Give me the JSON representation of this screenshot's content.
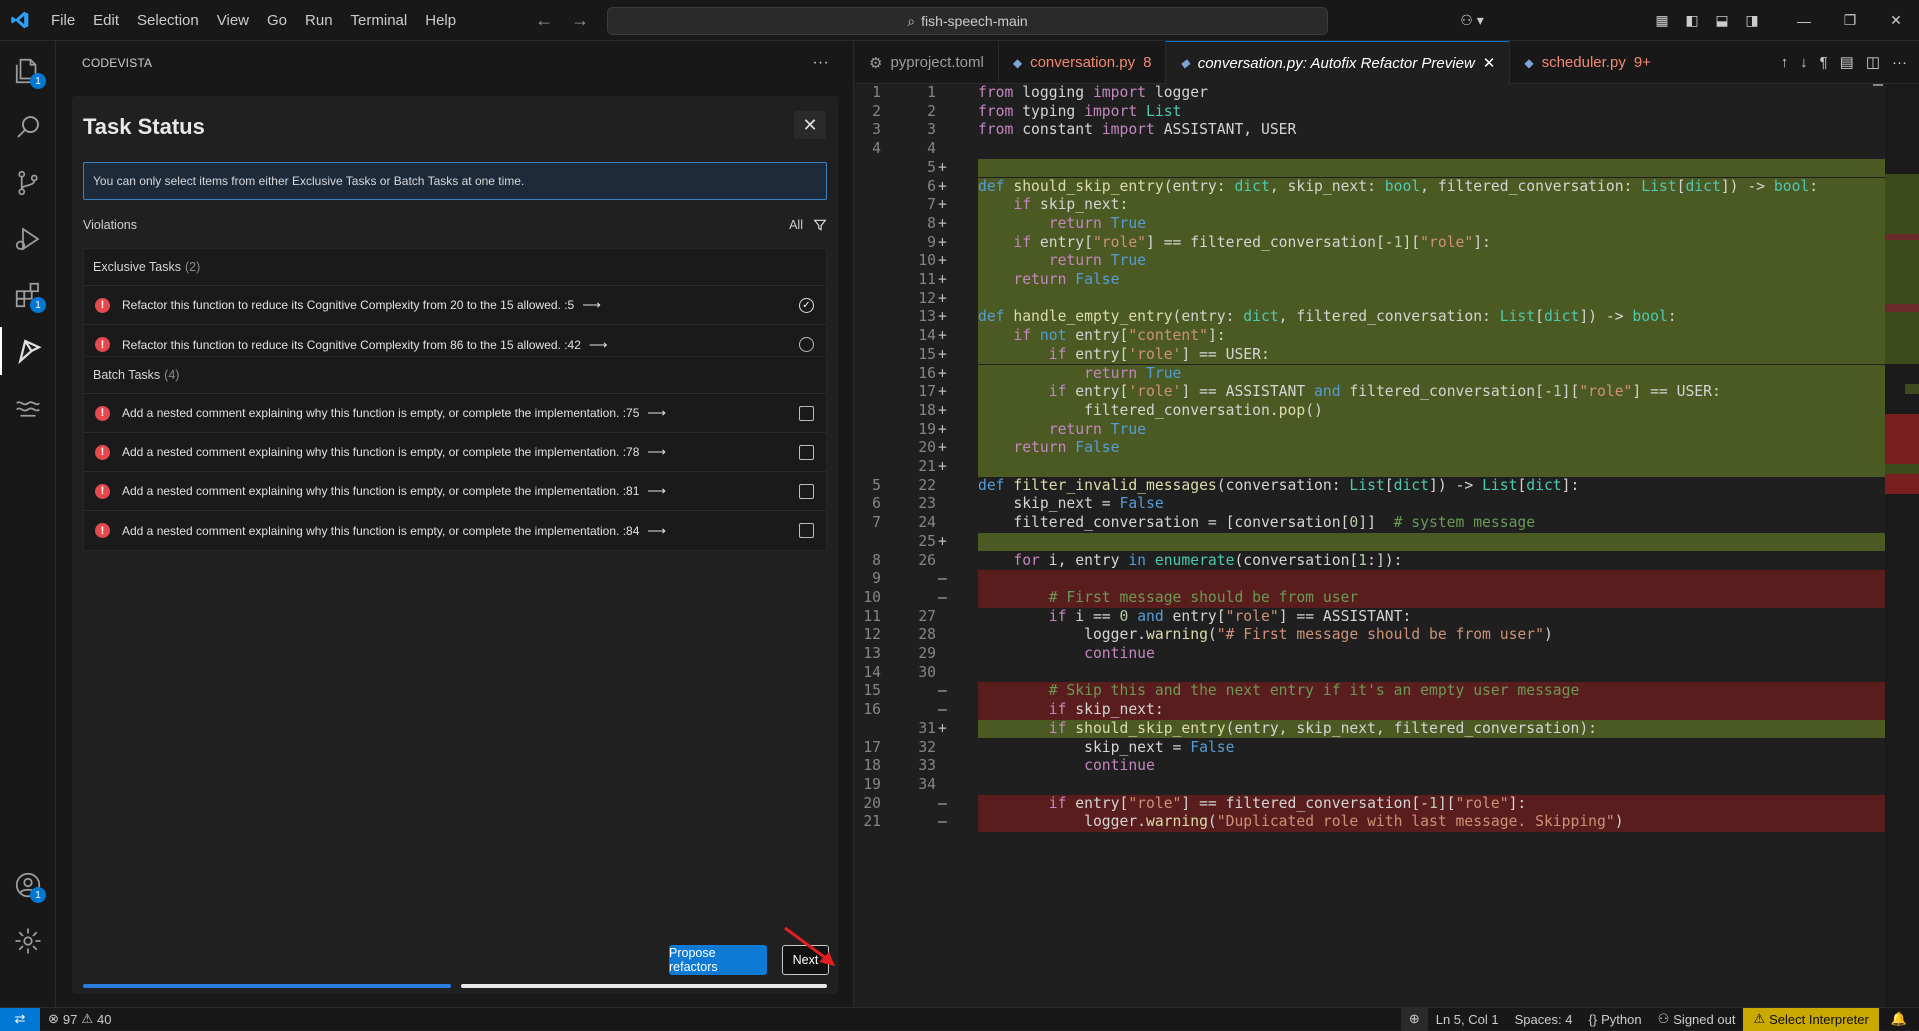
{
  "menu": [
    "File",
    "Edit",
    "Selection",
    "View",
    "Go",
    "Run",
    "Terminal",
    "Help"
  ],
  "search": {
    "text": "fish-speech-main"
  },
  "activity_badges": {
    "explorer": "1",
    "extensions": "1",
    "accounts": "1"
  },
  "sidebar": {
    "title": "CODEVISTA",
    "more": "···"
  },
  "panel": {
    "title": "Task Status",
    "close": "✕",
    "info": "You can only select items from either Exclusive Tasks or Batch Tasks at one time.",
    "violations_label": "Violations",
    "filter_label": "All",
    "exclusive": {
      "title": "Exclusive Tasks",
      "count": "(2)",
      "items": [
        {
          "text": "Refactor this function to reduce its Cognitive Complexity from 20 to the 15 allowed. :5",
          "state": "checked"
        },
        {
          "text": "Refactor this function to reduce its Cognitive Complexity from 86 to the 15 allowed. :42",
          "state": "unchecked"
        }
      ]
    },
    "batch": {
      "title": "Batch Tasks",
      "count": "(4)",
      "items": [
        {
          "text": "Add a nested comment explaining why this function is empty, or complete the implementation. :75"
        },
        {
          "text": "Add a nested comment explaining why this function is empty, or complete the implementation. :78"
        },
        {
          "text": "Add a nested comment explaining why this function is empty, or complete the implementation. :81"
        },
        {
          "text": "Add a nested comment explaining why this function is empty, or complete the implementation. :84"
        }
      ]
    },
    "propose_label": "Propose refactors",
    "next_label": "Next"
  },
  "tabs": [
    {
      "label": "pyproject.toml",
      "badge": ""
    },
    {
      "label": "conversation.py",
      "badge": "8"
    },
    {
      "label": "conversation.py: Autofix Refactor Preview",
      "badge": ""
    },
    {
      "label": "scheduler.py",
      "badge": "9+"
    }
  ],
  "editor": {
    "lines": [
      {
        "l": "1",
        "r": "1",
        "m": "",
        "t": "plain",
        "c": "from logging import logger"
      },
      {
        "l": "2",
        "r": "2",
        "m": "",
        "t": "plain",
        "c": "from typing import List"
      },
      {
        "l": "3",
        "r": "3",
        "m": "",
        "t": "plain",
        "c": "from constant import ASSISTANT, USER"
      },
      {
        "l": "4",
        "r": "4",
        "m": "",
        "t": "plain",
        "c": ""
      },
      {
        "l": "",
        "r": "5",
        "m": "+",
        "t": "add",
        "c": ""
      },
      {
        "l": "",
        "r": "6",
        "m": "+",
        "t": "add",
        "c": "def should_skip_entry(entry: dict, skip_next: bool, filtered_conversation: List[dict]) -> bool:"
      },
      {
        "l": "",
        "r": "7",
        "m": "+",
        "t": "add",
        "c": "    if skip_next:"
      },
      {
        "l": "",
        "r": "8",
        "m": "+",
        "t": "add",
        "c": "        return True"
      },
      {
        "l": "",
        "r": "9",
        "m": "+",
        "t": "add",
        "c": "    if entry[\"role\"] == filtered_conversation[-1][\"role\"]:"
      },
      {
        "l": "",
        "r": "10",
        "m": "+",
        "t": "add",
        "c": "        return True"
      },
      {
        "l": "",
        "r": "11",
        "m": "+",
        "t": "add",
        "c": "    return False"
      },
      {
        "l": "",
        "r": "12",
        "m": "+",
        "t": "add",
        "c": ""
      },
      {
        "l": "",
        "r": "13",
        "m": "+",
        "t": "add",
        "c": "def handle_empty_entry(entry: dict, filtered_conversation: List[dict]) -> bool:"
      },
      {
        "l": "",
        "r": "14",
        "m": "+",
        "t": "add",
        "c": "    if not entry[\"content\"]:"
      },
      {
        "l": "",
        "r": "15",
        "m": "+",
        "t": "add",
        "c": "        if entry['role'] == USER:"
      },
      {
        "l": "",
        "r": "16",
        "m": "+",
        "t": "add",
        "c": "            return True"
      },
      {
        "l": "",
        "r": "17",
        "m": "+",
        "t": "add",
        "c": "        if entry['role'] == ASSISTANT and filtered_conversation[-1][\"role\"] == USER:"
      },
      {
        "l": "",
        "r": "18",
        "m": "+",
        "t": "add",
        "c": "            filtered_conversation.pop()"
      },
      {
        "l": "",
        "r": "19",
        "m": "+",
        "t": "add",
        "c": "        return True"
      },
      {
        "l": "",
        "r": "20",
        "m": "+",
        "t": "add",
        "c": "    return False"
      },
      {
        "l": "",
        "r": "21",
        "m": "+",
        "t": "add",
        "c": ""
      },
      {
        "l": "5",
        "r": "22",
        "m": "",
        "t": "plain",
        "c": "def filter_invalid_messages(conversation: List[dict]) -> List[dict]:"
      },
      {
        "l": "6",
        "r": "23",
        "m": "",
        "t": "plain",
        "c": "    skip_next = False"
      },
      {
        "l": "7",
        "r": "24",
        "m": "",
        "t": "plain",
        "c": "    filtered_conversation = [conversation[0]]  # system message"
      },
      {
        "l": "",
        "r": "25",
        "m": "+",
        "t": "add",
        "c": ""
      },
      {
        "l": "8",
        "r": "26",
        "m": "",
        "t": "plain",
        "c": "    for i, entry in enumerate(conversation[1:]):"
      },
      {
        "l": "9",
        "r": "",
        "m": "—",
        "t": "del",
        "c": ""
      },
      {
        "l": "10",
        "r": "",
        "m": "—",
        "t": "del",
        "c": "        # First message should be from user"
      },
      {
        "l": "11",
        "r": "27",
        "m": "",
        "t": "plain",
        "c": "        if i == 0 and entry[\"role\"] == ASSISTANT:"
      },
      {
        "l": "12",
        "r": "28",
        "m": "",
        "t": "plain",
        "c": "            logger.warning(\"# First message should be from user\")"
      },
      {
        "l": "13",
        "r": "29",
        "m": "",
        "t": "plain",
        "c": "            continue"
      },
      {
        "l": "14",
        "r": "30",
        "m": "",
        "t": "plain",
        "c": ""
      },
      {
        "l": "15",
        "r": "",
        "m": "—",
        "t": "del",
        "c": "        # Skip this and the next entry if it's an empty user message"
      },
      {
        "l": "16",
        "r": "",
        "m": "—",
        "t": "del",
        "c": "        if skip_next:"
      },
      {
        "l": "",
        "r": "31",
        "m": "+",
        "t": "add",
        "c": "        if should_skip_entry(entry, skip_next, filtered_conversation):"
      },
      {
        "l": "17",
        "r": "32",
        "m": "",
        "t": "plain",
        "c": "            skip_next = False"
      },
      {
        "l": "18",
        "r": "33",
        "m": "",
        "t": "plain",
        "c": "            continue"
      },
      {
        "l": "19",
        "r": "34",
        "m": "",
        "t": "plain",
        "c": ""
      },
      {
        "l": "20",
        "r": "",
        "m": "—",
        "t": "del",
        "c": "        if entry[\"role\"] == filtered_conversation[-1][\"role\"]:"
      },
      {
        "l": "21",
        "r": "",
        "m": "—",
        "t": "del",
        "c": "            logger.warning(\"Duplicated role with last message. Skipping\")"
      }
    ]
  },
  "statusbar": {
    "errors": "97",
    "warnings": "40",
    "position": "Ln 5, Col 1",
    "spaces": "Spaces: 4",
    "language": "Python",
    "account": "Signed out",
    "interpreter": "Select Interpreter"
  },
  "colors": {
    "accent": "#0078d4",
    "added": "#4b5a22",
    "removed": "#5a1d1d",
    "error": "#e5484d"
  }
}
